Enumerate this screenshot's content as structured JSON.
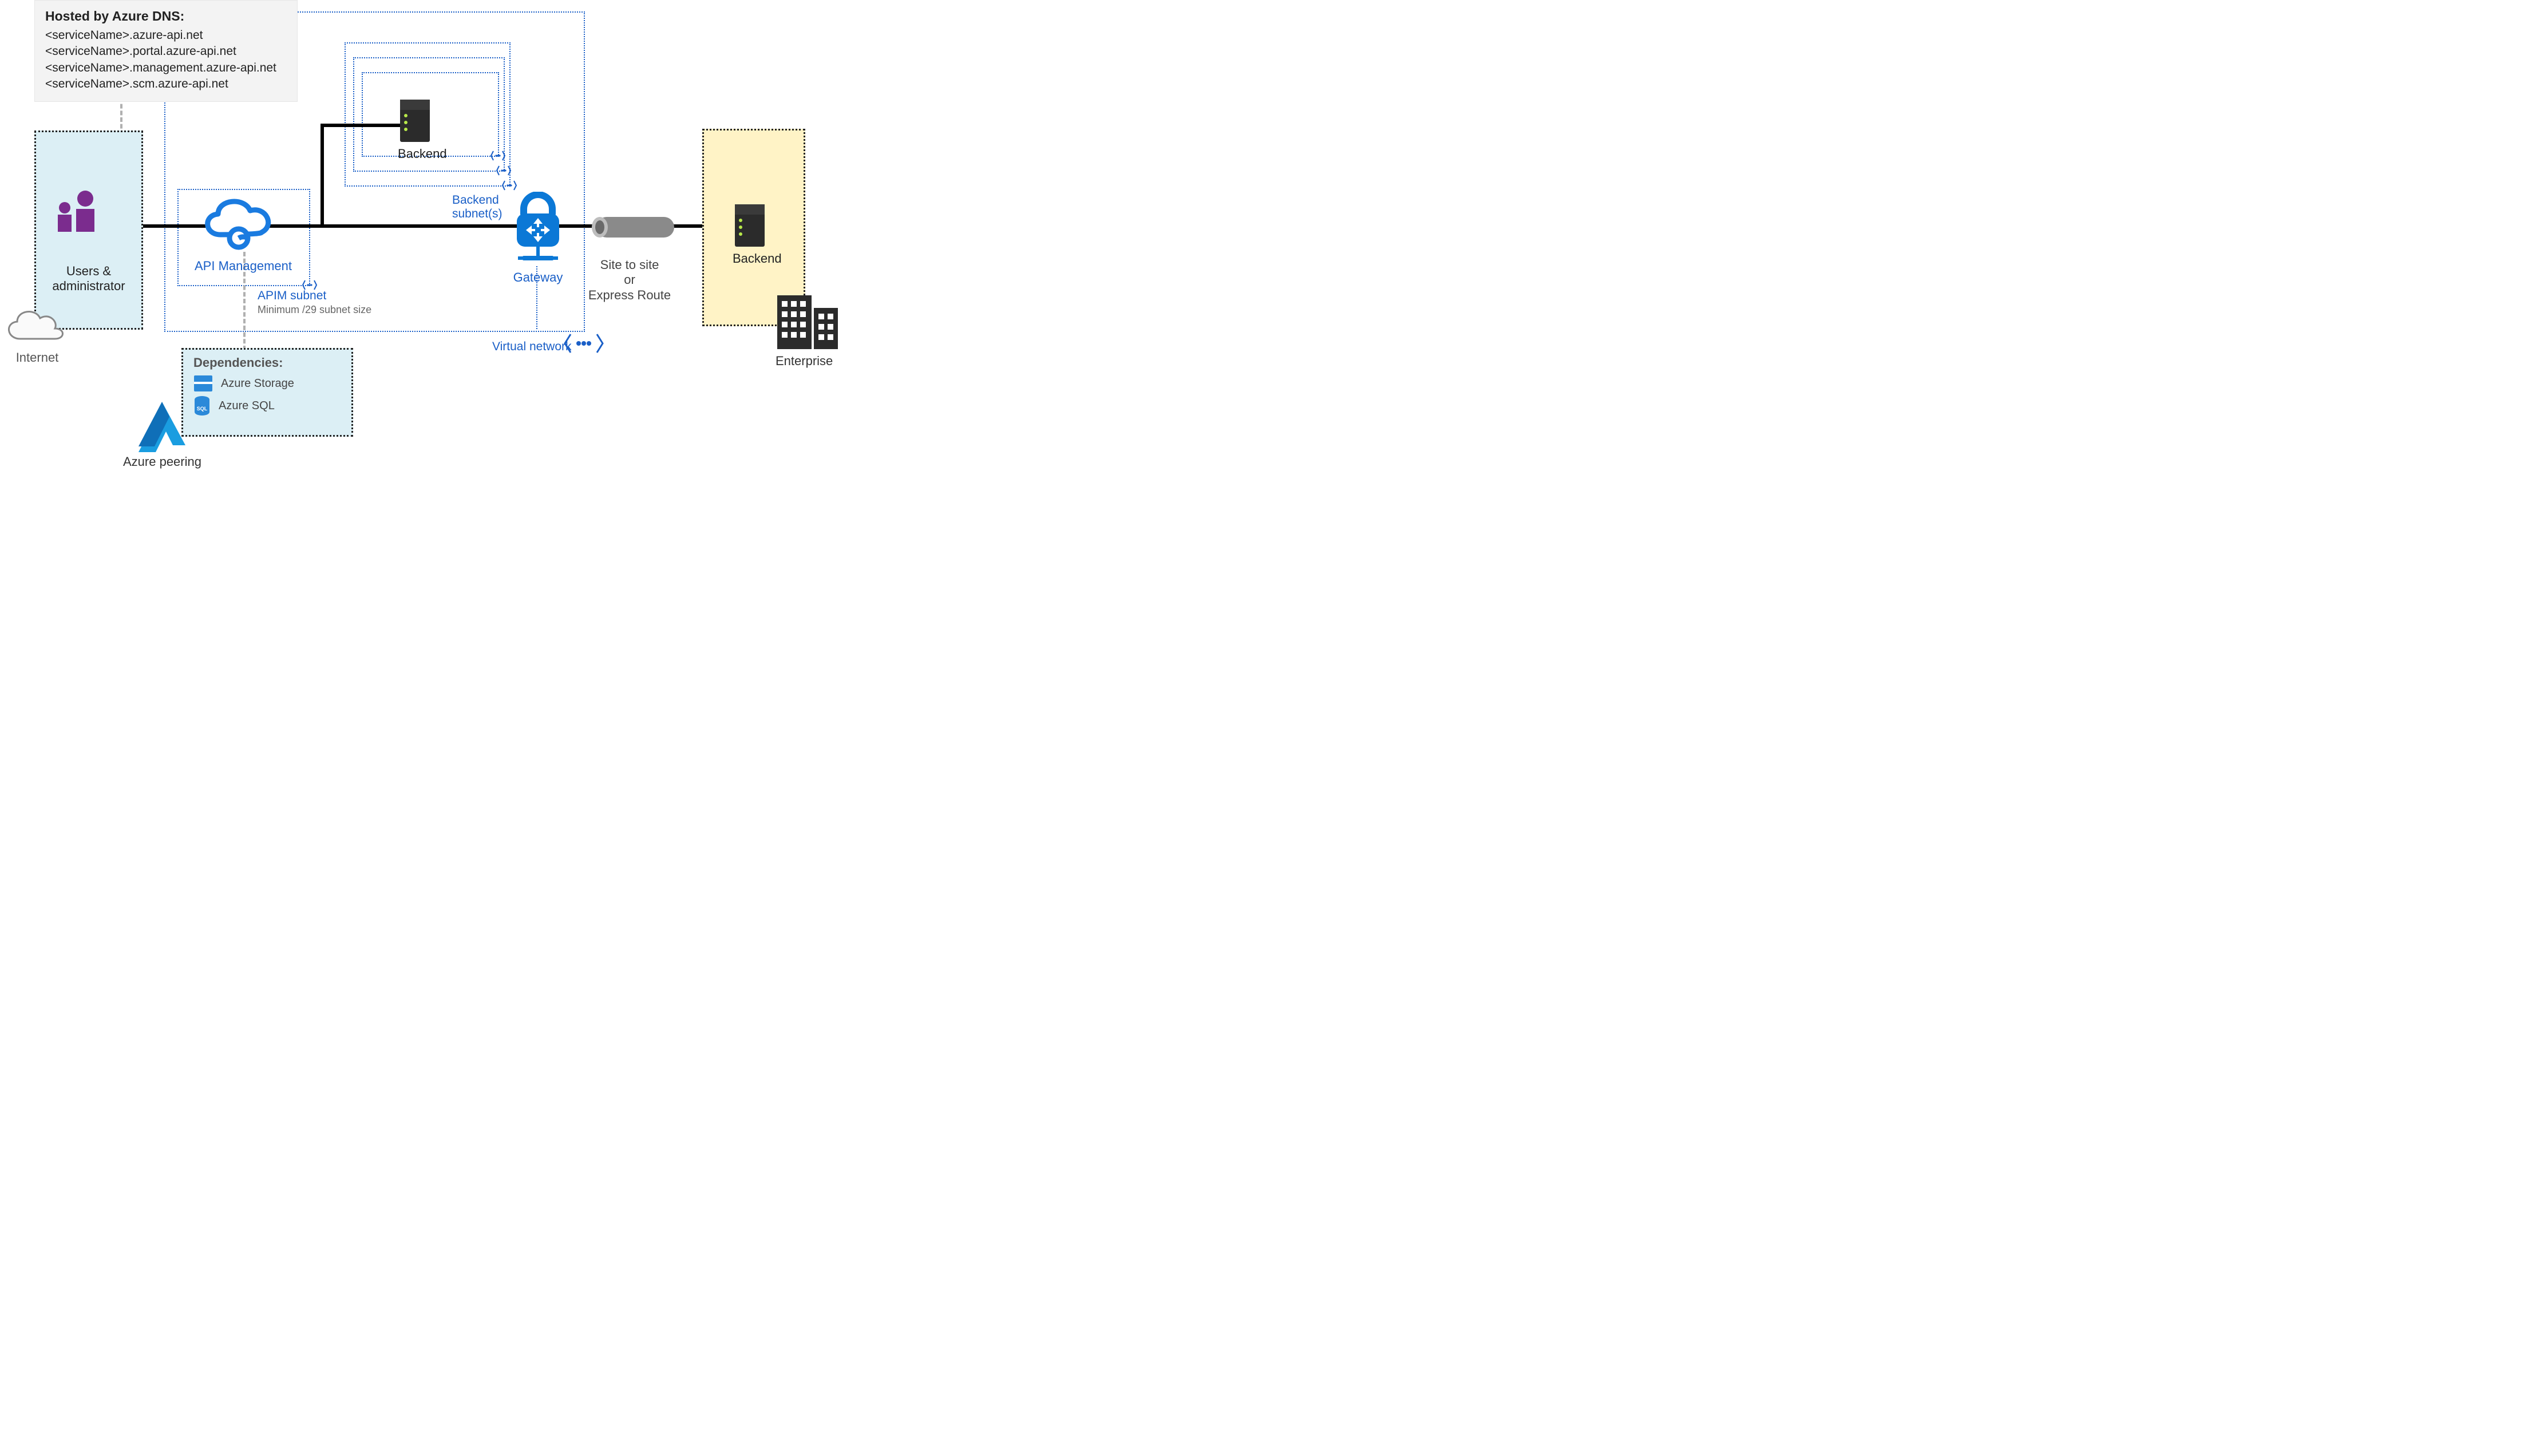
{
  "dns": {
    "title": "Hosted by Azure DNS:",
    "lines": [
      "<serviceName>.azure-api.net",
      "<serviceName>.portal.azure-api.net",
      "<serviceName>.management.azure-api.net",
      "<serviceName>.scm.azure-api.net"
    ]
  },
  "users_label_line1": "Users &",
  "users_label_line2": "administrator",
  "internet_label": "Internet",
  "apim_label": "API Management",
  "apim_subnet_label": "APIM subnet",
  "apim_subnet_note": "Minimum /29 subnet size",
  "backend_internal_label": "Backend",
  "backend_subnets_label_line1": "Backend",
  "backend_subnets_label_line2": "subnet(s)",
  "gateway_label": "Gateway",
  "vnet_label": "Virtual network",
  "pipe_label_line1": "Site to site",
  "pipe_label_line2": "or",
  "pipe_label_line3": "Express Route",
  "enterprise_backend_label": "Backend",
  "enterprise_label": "Enterprise",
  "dependencies_title": "Dependencies:",
  "dep_storage": "Azure Storage",
  "dep_sql": "Azure SQL",
  "azure_peering_label": "Azure peering",
  "colors": {
    "azure_blue": "#1a5fc7",
    "users_purple": "#7b2c8e",
    "cloud_fill": "#f8f8f8",
    "users_bg": "#dceff5",
    "ent_bg": "#fff3c6"
  }
}
